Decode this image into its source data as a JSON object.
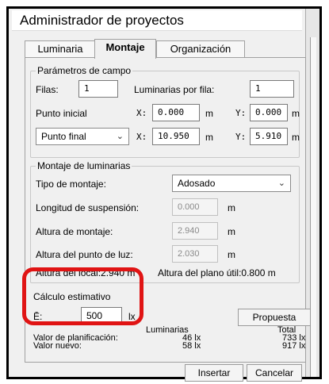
{
  "window": {
    "title": "Administrador de proyectos"
  },
  "tabs": [
    {
      "label": "Luminaria",
      "active": false
    },
    {
      "label": "Montaje",
      "active": true
    },
    {
      "label": "Organización",
      "active": false
    }
  ],
  "campo": {
    "title": "Parámetros de campo",
    "filas_label": "Filas:",
    "filas_value": "1",
    "lum_por_fila_label": "Luminarias por fila:",
    "lum_por_fila_value": "1",
    "punto_inicial_label": "Punto inicial",
    "pi_x_label": "X:",
    "pi_x_value": "0.000",
    "pi_x_unit": "m",
    "pi_y_label": "Y:",
    "pi_y_value": "0.000",
    "pi_y_unit": "m",
    "punto_final_select": "Punto final",
    "pf_x_label": "X:",
    "pf_x_value": "10.950",
    "pf_x_unit": "m",
    "pf_y_label": "Y:",
    "pf_y_value": "5.910",
    "pf_y_unit": "m"
  },
  "montaje": {
    "title": "Montaje de luminarias",
    "tipo_label": "Tipo de montaje:",
    "tipo_value": "Adosado",
    "longitud_label": "Longitud de suspensión:",
    "longitud_value": "0.000",
    "longitud_unit": "m",
    "altura_label": "Altura de montaje:",
    "altura_value": "2.940",
    "altura_unit": "m",
    "altura_punto_label": "Altura del punto de luz:",
    "altura_punto_value": "2.030",
    "altura_punto_unit": "m",
    "altura_local_text": "Altura del local:2.940 m",
    "altura_plano_text": "Altura del plano útil:0.800 m"
  },
  "calculo": {
    "title": "Cálculo estimativo",
    "e_label": "Ē:",
    "e_value": "500",
    "e_unit": "lx",
    "propuesta_label": "Propuesta",
    "col_luminarias": "Luminarias",
    "col_total": "Total",
    "rows": [
      {
        "label": "Valor de planificación:",
        "luminarias": "46 lx",
        "total": "733 lx"
      },
      {
        "label": "Valor nuevo:",
        "luminarias": "58 lx",
        "total": "917 lx"
      }
    ]
  },
  "footer": {
    "insertar_label": "Insertar",
    "cancelar_label": "Cancelar"
  },
  "colors": {
    "highlight": "#e01414"
  }
}
